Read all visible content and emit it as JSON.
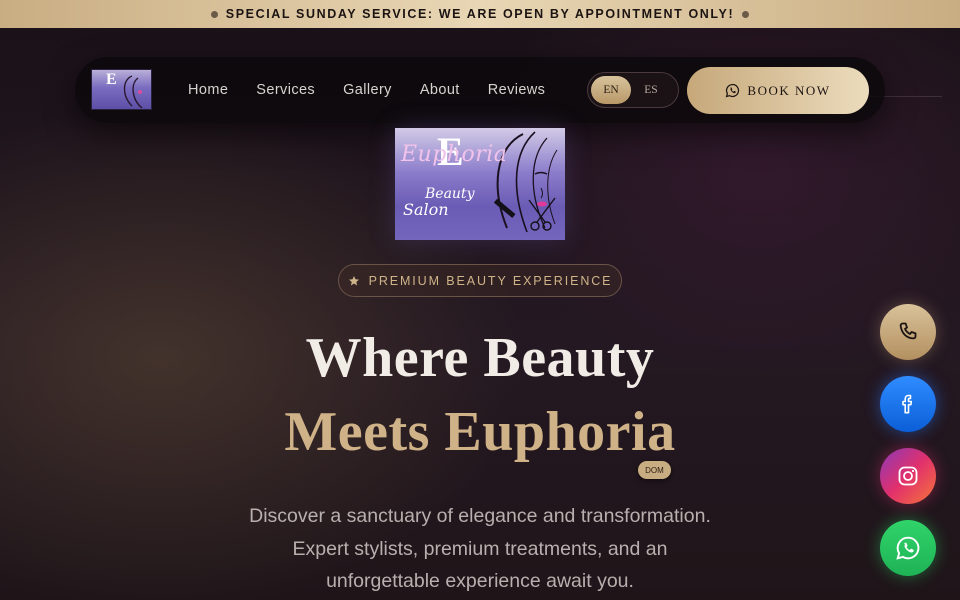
{
  "announcement": {
    "text": "SPECIAL SUNDAY SERVICE: WE ARE OPEN BY APPOINTMENT ONLY!"
  },
  "nav": {
    "links": [
      "Home",
      "Services",
      "Gallery",
      "About",
      "Reviews"
    ],
    "languages": [
      {
        "code": "EN",
        "active": true
      },
      {
        "code": "ES",
        "active": false
      }
    ],
    "book_label": "BOOK NOW",
    "book_icon": "whatsapp-icon"
  },
  "logo": {
    "letter": "E",
    "word": "Euphoria",
    "line1": "Beauty",
    "line2": "Salon"
  },
  "badge": {
    "icon": "star-icon",
    "text": "PREMIUM BEAUTY EXPERIENCE"
  },
  "headline": {
    "line1": "Where Beauty",
    "line2": "Meets Euphoria"
  },
  "dom_tag": "DOM",
  "description": {
    "line1": "Discover a sanctuary of elegance and transformation.",
    "line2": "Expert stylists, premium treatments, and an",
    "line3": "unforgettable experience await you."
  },
  "floating_actions": [
    {
      "name": "phone",
      "icon": "phone-icon"
    },
    {
      "name": "facebook",
      "icon": "facebook-icon"
    },
    {
      "name": "instagram",
      "icon": "instagram-icon"
    },
    {
      "name": "whatsapp",
      "icon": "whatsapp-icon"
    }
  ],
  "colors": {
    "gold": "#c9ad82",
    "gold_text": "#cfb287",
    "background": "#1b1219",
    "facebook": "#1877f2",
    "whatsapp": "#25d366"
  }
}
